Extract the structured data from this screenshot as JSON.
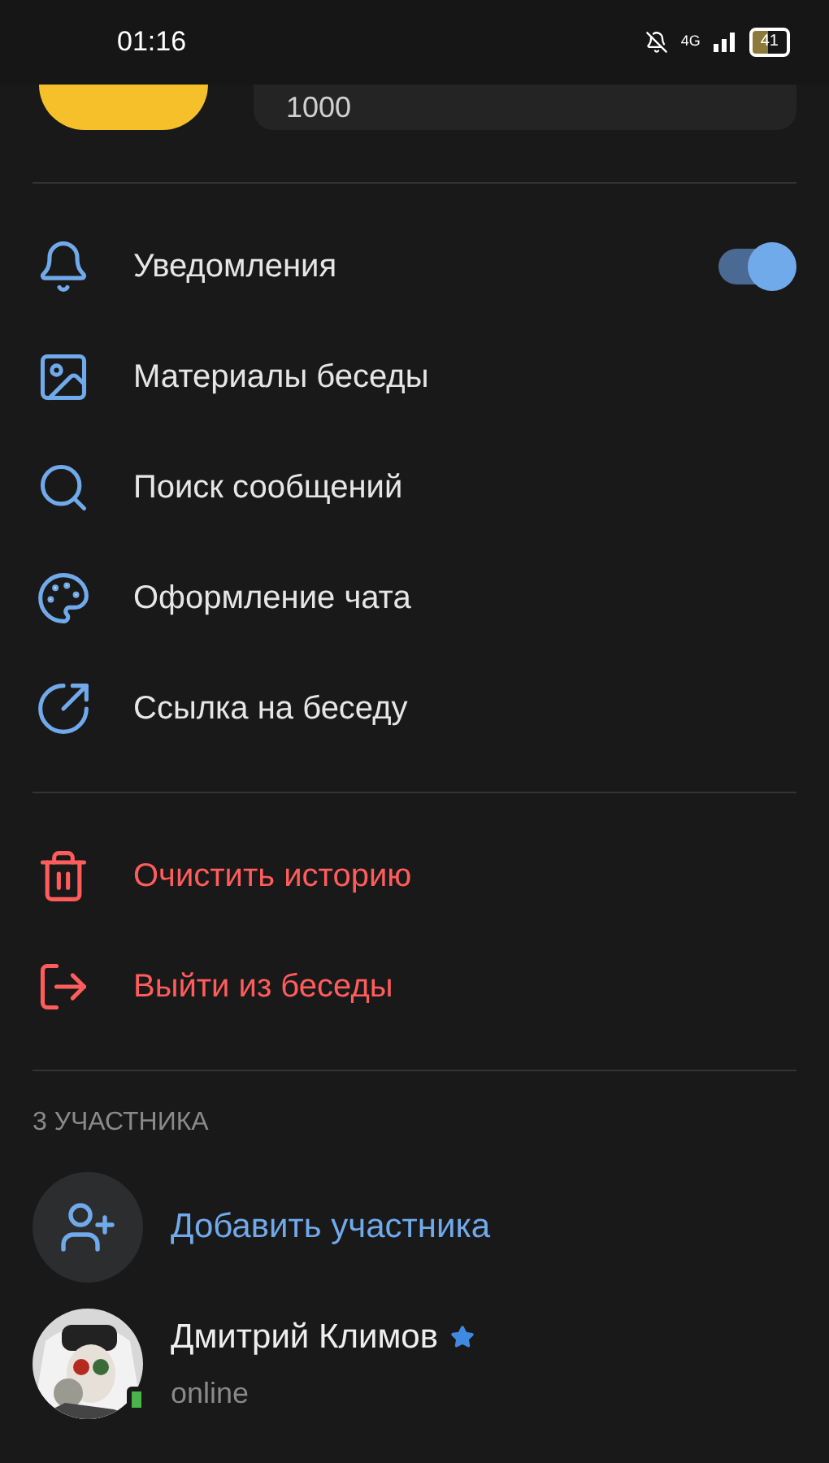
{
  "status_bar": {
    "time": "01:16",
    "network": "4G",
    "battery": "41"
  },
  "header": {
    "field_value": "1000"
  },
  "menu": [
    {
      "kind": "toggle",
      "label": "Уведомления",
      "on": true
    },
    {
      "kind": "normal",
      "label": "Материалы беседы"
    },
    {
      "kind": "normal",
      "label": "Поиск сообщений"
    },
    {
      "kind": "normal",
      "label": "Оформление чата"
    },
    {
      "kind": "normal",
      "label": "Ссылка на беседу"
    }
  ],
  "danger_menu": [
    {
      "label": "Очистить историю"
    },
    {
      "label": "Выйти из беседы"
    }
  ],
  "members": {
    "heading": "3 УЧАСТНИКА",
    "add_label": "Добавить участника",
    "list": [
      {
        "name": "Дмитрий Климов",
        "status": "online",
        "admin": true,
        "online": true
      }
    ]
  }
}
